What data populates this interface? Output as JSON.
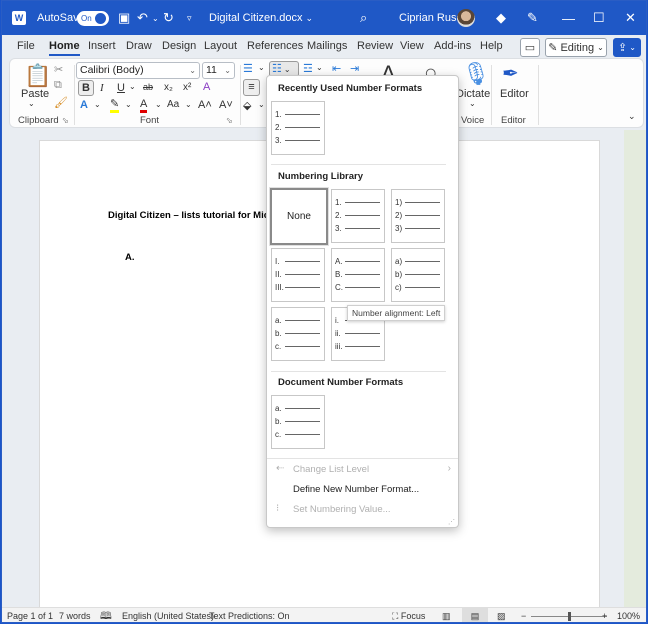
{
  "titlebar": {
    "app_icon": "word-icon",
    "autosave_label": "AutoSave",
    "autosave_state": "On",
    "save_icon": "save-icon",
    "undo_icon": "undo-icon",
    "redo_icon": "redo-icon",
    "customize_icon": "customize-quick-access-icon",
    "doc_title": "Digital Citizen.docx",
    "search_icon": "search-icon",
    "user_name": "Ciprian Rusen",
    "premium_icon": "diamond-icon",
    "pen_icon": "pen-icon",
    "minimize": "—",
    "maximize": "☐",
    "close": "✕"
  },
  "menu": {
    "tabs": [
      "File",
      "Home",
      "Insert",
      "Draw",
      "Design",
      "Layout",
      "References",
      "Mailings",
      "Review",
      "View",
      "Add-ins",
      "Help"
    ],
    "active_tab": "Home",
    "comments_icon": "comment-icon",
    "editing_label": "Editing",
    "share_icon": "share-icon"
  },
  "ribbon": {
    "clipboard": {
      "paste_label": "Paste",
      "group_label": "Clipboard"
    },
    "font": {
      "font_name": "Calibri (Body)",
      "font_size": "11",
      "bold": "B",
      "italic": "I",
      "underline": "U",
      "strikethrough": "ab",
      "subscript": "x₂",
      "superscript": "x²",
      "text_effects": "A",
      "highlight": "A",
      "font_color": "A",
      "change_case": "Aa",
      "grow": "A˄",
      "shrink": "A˅",
      "group_label": "Font"
    },
    "voice": {
      "dictate_label": "Dictate",
      "group_label": "Voice"
    },
    "editor": {
      "editor_label": "Editor",
      "group_label": "Editor"
    }
  },
  "document": {
    "heading": "Digital Citizen – lists tutorial for Micro",
    "list_marker": "A."
  },
  "dropdown": {
    "recent_header": "Recently Used Number Formats",
    "recent": [
      [
        "1.",
        "2.",
        "3."
      ]
    ],
    "library_header": "Numbering Library",
    "library": [
      {
        "type": "none",
        "label": "None"
      },
      {
        "type": "list",
        "items": [
          "1.",
          "2.",
          "3."
        ]
      },
      {
        "type": "list",
        "items": [
          "1)",
          "2)",
          "3)"
        ]
      },
      {
        "type": "list",
        "items": [
          "I.",
          "II.",
          "III."
        ]
      },
      {
        "type": "list",
        "items": [
          "A.",
          "B.",
          "C."
        ]
      },
      {
        "type": "list",
        "items": [
          "a)",
          "b)",
          "c)"
        ]
      },
      {
        "type": "list",
        "items": [
          "a.",
          "b.",
          "c."
        ]
      },
      {
        "type": "list",
        "items": [
          "i.",
          "ii.",
          "iii."
        ]
      }
    ],
    "tooltip": "Number alignment: Left",
    "document_header": "Document Number Formats",
    "document_formats": [
      [
        "a.",
        "b.",
        "c."
      ]
    ],
    "change_level": "Change List Level",
    "define_new": "Define New Number Format...",
    "set_value": "Set Numbering Value..."
  },
  "statusbar": {
    "page": "Page 1 of 1",
    "words": "7 words",
    "language": "English (United States)",
    "predictions": "Text Predictions: On",
    "focus": "Focus",
    "zoom_level": "100%",
    "zoom_fraction": 0.5
  },
  "colors": {
    "accent": "#1f58c6",
    "highlight_yellow": "#ffff00",
    "font_red": "#e00000"
  }
}
